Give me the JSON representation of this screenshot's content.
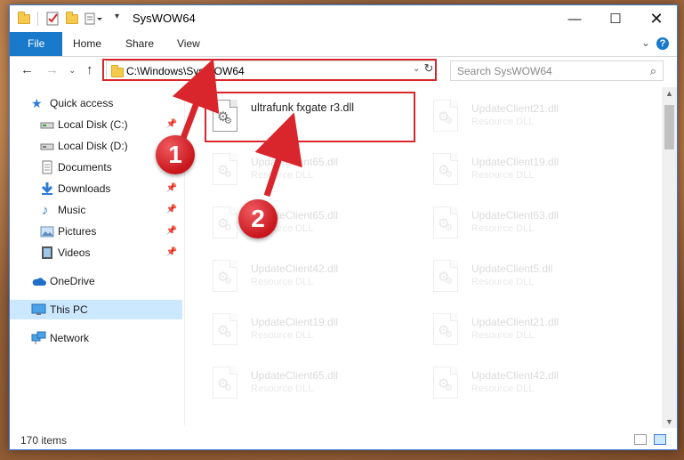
{
  "window": {
    "title": "SysWOW64"
  },
  "ribbon": {
    "tabs": [
      "File",
      "Home",
      "Share",
      "View"
    ],
    "help": "?"
  },
  "nav": {
    "address": "C:\\Windows\\SysWOW64",
    "search_placeholder": "Search SysWOW64"
  },
  "sidebar": {
    "items": [
      {
        "label": "Quick access",
        "icon": "star-icon"
      },
      {
        "label": "Local Disk (C:)",
        "icon": "drive-icon",
        "pinned": true
      },
      {
        "label": "Local Disk (D:)",
        "icon": "drive-icon"
      },
      {
        "label": "Documents",
        "icon": "documents-icon"
      },
      {
        "label": "Downloads",
        "icon": "download-icon",
        "pinned": true
      },
      {
        "label": "Music",
        "icon": "music-icon",
        "pinned": true
      },
      {
        "label": "Pictures",
        "icon": "pictures-icon",
        "pinned": true
      },
      {
        "label": "Videos",
        "icon": "videos-icon",
        "pinned": true
      },
      {
        "label": "OneDrive",
        "icon": "cloud-icon"
      },
      {
        "label": "This PC",
        "icon": "computer-icon",
        "selected": true
      },
      {
        "label": "Network",
        "icon": "network-icon"
      }
    ]
  },
  "files": {
    "highlighted": {
      "name": "ultrafunk fxgate r3.dll"
    },
    "tiles": [
      {
        "name": "UpdateClient21.dll",
        "type": "Resource DLL"
      },
      {
        "name": "UpdateClient65.dll",
        "type": "Resource DLL"
      },
      {
        "name": "UpdateClient19.dll",
        "type": "Resource DLL"
      },
      {
        "name": "UpdateClient65.dll",
        "type": "Resource DLL"
      },
      {
        "name": "UpdateClient63.dll",
        "type": "Resource DLL"
      },
      {
        "name": "UpdateClient42.dll",
        "type": "Resource DLL"
      },
      {
        "name": "UpdateClient5.dll",
        "type": "Resource DLL"
      },
      {
        "name": "UpdateClient19.dll",
        "type": "Resource DLL"
      },
      {
        "name": "UpdateClient21.dll",
        "type": "Resource DLL"
      },
      {
        "name": "UpdateClient65.dll",
        "type": "Resource DLL"
      },
      {
        "name": "UpdateClient42.dll",
        "type": "Resource DLL"
      }
    ]
  },
  "status": {
    "item_count": "170 items"
  },
  "annotations": {
    "badge1": "1",
    "badge2": "2",
    "color": "#d9262c"
  }
}
